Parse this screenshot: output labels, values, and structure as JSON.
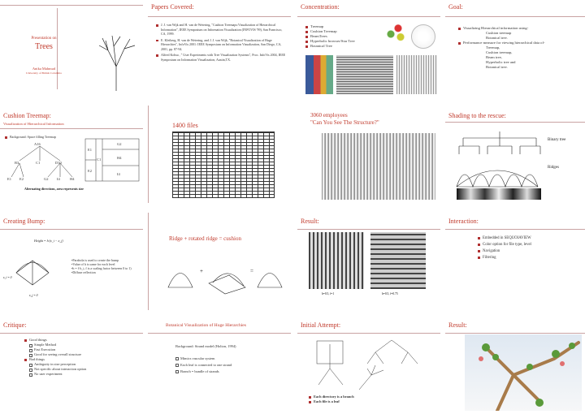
{
  "s1": {
    "pres": "Presentation on",
    "title": "Trees",
    "author": "Anika Mahmud",
    "univ": "University of British Columbia"
  },
  "s2": {
    "title": "Papers Covered:",
    "items": [
      "J. J. van Wijk and H. van de Wetering, \"Cushion Treemaps:Visualization of Hierarchical Information\", IEEE Symposium on Information Visualization (INFOVIS '99), San Francisco, CA, 1999.",
      "E. Kleiberg, H. van de Wetering, and J. J. van Wijk, \"Botanical Visualization of Huge Hierarchies\", InfoVis 2001: IEEE Symposium on Information Visualization, San Diego, CA, 2001, pp. 87-94.",
      "Alfred Kobsa , \" User Experiments with Tree Visualization Systems\", Proc. InfoVis 2004, IEEE Symposium on Information Visualization, Austin,TX."
    ]
  },
  "s3": {
    "title": "Concentration:",
    "items": [
      "Treemap",
      "Cushion Treemap",
      "BeamTrees",
      "Hyperbolic browser/Star Tree",
      "Botanical Tree"
    ]
  },
  "s4": {
    "title": "Goal:",
    "items": [
      "Visualizing Hierarchical information using-",
      "Cushion treemap",
      "Botanical tree.",
      "Performance measure for viewing hierarchical data of-",
      "Treemap,",
      "Cushion treemap,",
      "Beam tree,",
      "Hyperbolic tree and",
      "Botanical tree."
    ]
  },
  "s5": {
    "title": "Cushion Treemap:",
    "subtitle": "Visualization of Hierarchical Information",
    "bullet": "Background: Space filling Treemap",
    "labels": [
      "A16",
      "B3",
      "C1",
      "D10",
      "E1",
      "E2",
      "E3",
      "E4",
      "G2",
      "H4",
      "H4",
      "I1"
    ],
    "caption": "Alternating directions, area represents size"
  },
  "s6": {
    "label": "1400 files"
  },
  "s7": {
    "line1": "3060 employees",
    "line2": "\"Can You See The Structure?\""
  },
  "s8": {
    "title": "Shading to the rescue:",
    "label1": "Binary tree",
    "label2": "Ridges"
  },
  "s9": {
    "title": "Creating Bump:",
    "formula": "Height = h·(x_i − x_j)",
    "points": [
      "•Parabola is used to create the bump",
      "•Value of h is same for each level",
      "•h = f·h_i, f is a scaling factor between 0 to 1)",
      "•Diffuse reflection"
    ],
    "lbl1": "x_i = 0",
    "lbl2": "x_j = 0"
  },
  "s10": {
    "title": "Ridge + rotated ridge = cushion",
    "plus": "+",
    "eq": "="
  },
  "s11": {
    "title": "Result:",
    "cap1": "h=0.5, f=1",
    "cap2": "h=0.5, f=0.75"
  },
  "s12": {
    "title": "Interaction:",
    "items": [
      "Embedded in SEQUOIAVIEW",
      "Color option for file type, level",
      "Navigation",
      "Filtering"
    ]
  },
  "s13": {
    "title": "Critique:",
    "good": "Good things",
    "goods": [
      "Simple Method",
      "Fast Execution",
      "Good for seeing overall structure"
    ],
    "bad": "Bad things",
    "bads": [
      "Ambiguity in size perception",
      "Not specific about interaction option",
      "No user experiment"
    ]
  },
  "s14": {
    "title": "Botanical Visualization of Huge Hierarchies",
    "bg": "Background: Strand model (Holton, 1994)",
    "items": [
      "Mimics vascular system",
      "Each leaf is connected to one strand",
      "Branch = bundle of strands"
    ]
  },
  "s15": {
    "title": "Initial Attempt:",
    "items": [
      "Each directory is a branch",
      "Each file is a leaf"
    ]
  },
  "s16": {
    "title": "Result:"
  },
  "colors": {
    "accent": "#c0392b",
    "title": "#c0392b",
    "rule": "#c9a3a3",
    "cushion_blue": "#3a5a9a"
  }
}
